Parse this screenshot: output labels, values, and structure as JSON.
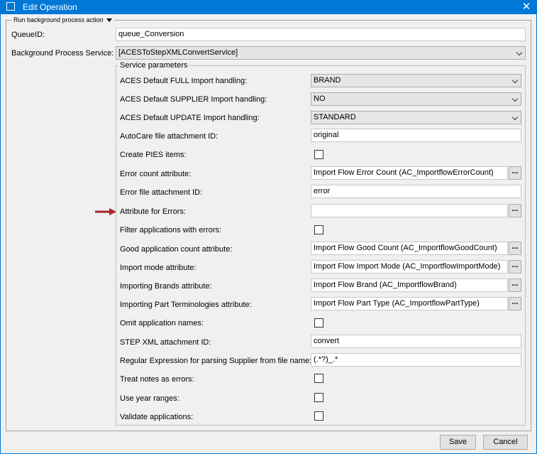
{
  "window": {
    "title": "Edit Operation"
  },
  "group": {
    "legend": "Run background process action"
  },
  "queue": {
    "label": "QueueID:",
    "value": "queue_Conversion"
  },
  "service": {
    "label": "Background Process Service:",
    "value": "[ACESToStepXMLConvertService]"
  },
  "params": {
    "legend": "Service parameters",
    "full_label": "ACES Default FULL Import handling:",
    "full_value": "BRAND",
    "supplier_label": "ACES Default SUPPLIER Import handling:",
    "supplier_value": "NO",
    "update_label": "ACES Default UPDATE Import handling:",
    "update_value": "STANDARD",
    "autocare_label": "AutoCare file attachment ID:",
    "autocare_value": "original",
    "pies_label": "Create PIES items:",
    "errcount_label": "Error count attribute:",
    "errcount_value": "Import Flow Error Count (AC_ImportflowErrorCount)",
    "errfile_label": "Error file attachment ID:",
    "errfile_value": "error",
    "attrerr_label": "Attribute for Errors:",
    "attrerr_value": "",
    "filter_label": "Filter applications with errors:",
    "good_label": "Good application count attribute:",
    "good_value": "Import Flow Good Count (AC_ImportflowGoodCount)",
    "mode_label": "Import mode attribute:",
    "mode_value": "Import Flow Import Mode (AC_ImportflowImportMode)",
    "brands_label": "Importing Brands attribute:",
    "brands_value": "Import Flow Brand (AC_ImportflowBrand)",
    "parts_label": "Importing Part Terminologies attribute:",
    "parts_value": "Import Flow Part Type (AC_ImportflowPartType)",
    "omit_label": "Omit application names:",
    "stepxml_label": "STEP XML attachment ID:",
    "stepxml_value": "convert",
    "regex_label": "Regular Expression for parsing Supplier from file name:",
    "regex_value": "(.*?)_.*",
    "notes_label": "Treat notes as errors:",
    "years_label": "Use year ranges:",
    "validate_label": "Validate applications:",
    "ellipsis": "..."
  },
  "buttons": {
    "save": "Save",
    "cancel": "Cancel"
  },
  "colors": {
    "titlebar": "#0078d7",
    "arrow": "#a3262a"
  }
}
